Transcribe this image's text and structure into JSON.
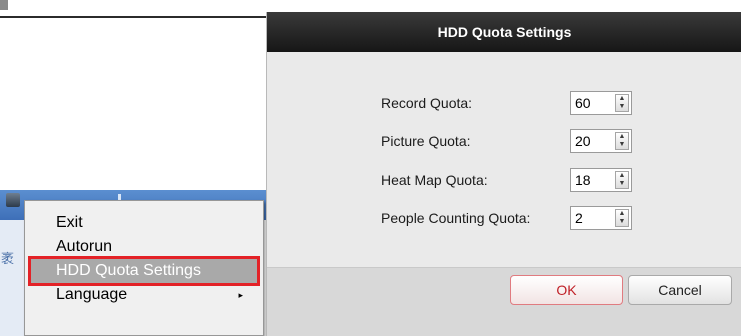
{
  "context_menu": {
    "items": [
      {
        "label": "Exit"
      },
      {
        "label": "Autorun"
      },
      {
        "label": "HDD Quota Settings",
        "highlighted": true
      },
      {
        "label": "Language",
        "has_submenu": true
      }
    ],
    "submenu_arrow": "▸"
  },
  "dialog": {
    "title": "HDD Quota Settings",
    "fields": [
      {
        "label": "Record Quota:",
        "value": "60"
      },
      {
        "label": "Picture Quota:",
        "value": "20"
      },
      {
        "label": "Heat Map Quota:",
        "value": "18"
      },
      {
        "label": "People Counting Quota:",
        "value": "2"
      }
    ],
    "ok_label": "OK",
    "cancel_label": "Cancel"
  },
  "colors": {
    "highlight_outline": "#e32227",
    "dialog_header": "#1f1f1f",
    "ok_text": "#c02027"
  },
  "icons": {
    "spin_up": "▲",
    "spin_down": "▼"
  }
}
